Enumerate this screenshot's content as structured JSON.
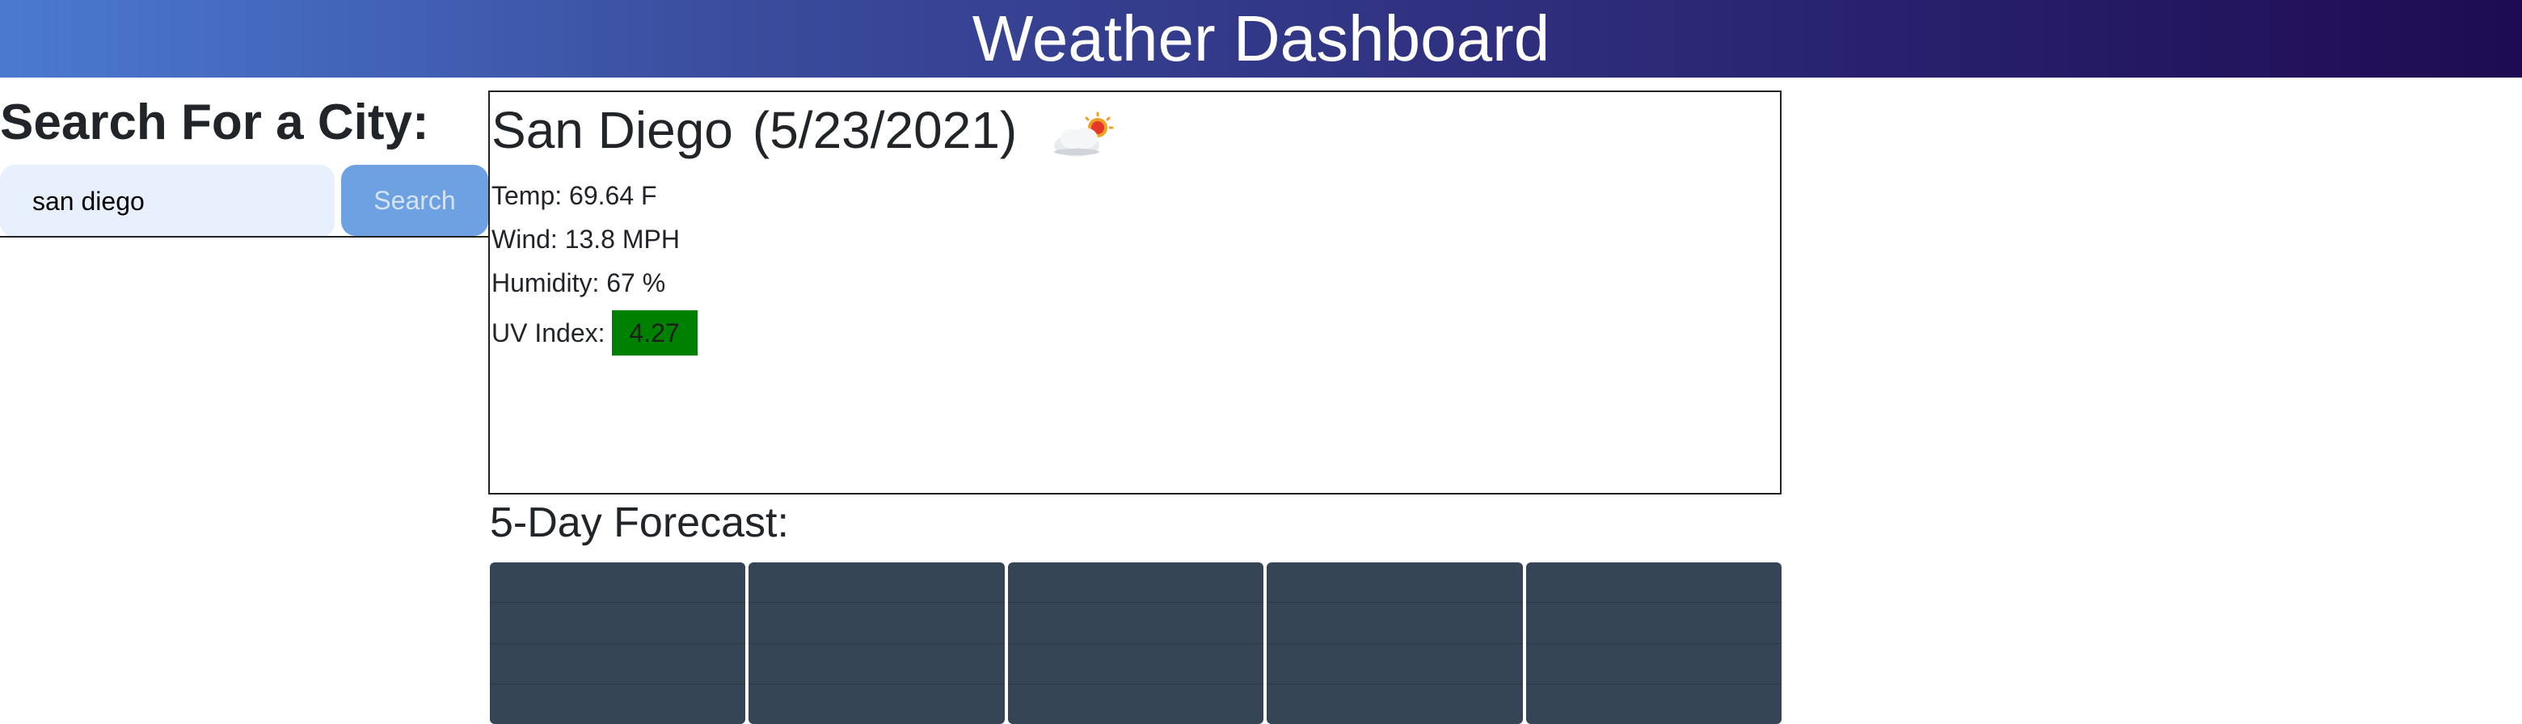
{
  "header": {
    "title": "Weather Dashboard"
  },
  "search": {
    "title": "Search For a City:",
    "input_value": "san diego",
    "button_label": "Search"
  },
  "current": {
    "city": "San Diego",
    "date": "(5/23/2021)",
    "icon": "partly-cloudy-day-icon",
    "temp": "Temp: 69.64 F",
    "wind": "Wind: 13.8 MPH",
    "humidity": "Humidity: 67 %",
    "uv_label": "UV Index:",
    "uv_value": "4.27"
  },
  "forecast": {
    "title": "5-Day Forecast:",
    "days": [
      {
        "date": "",
        "temp": "",
        "wind": "",
        "humidity": ""
      },
      {
        "date": "",
        "temp": "",
        "wind": "",
        "humidity": ""
      },
      {
        "date": "",
        "temp": "",
        "wind": "",
        "humidity": ""
      },
      {
        "date": "",
        "temp": "",
        "wind": "",
        "humidity": ""
      },
      {
        "date": "",
        "temp": "",
        "wind": "",
        "humidity": ""
      }
    ]
  },
  "colors": {
    "uv_badge": "#008000",
    "forecast_card": "#364556",
    "search_button": "#6ea1e2",
    "search_input_bg": "#e8f0fe"
  }
}
